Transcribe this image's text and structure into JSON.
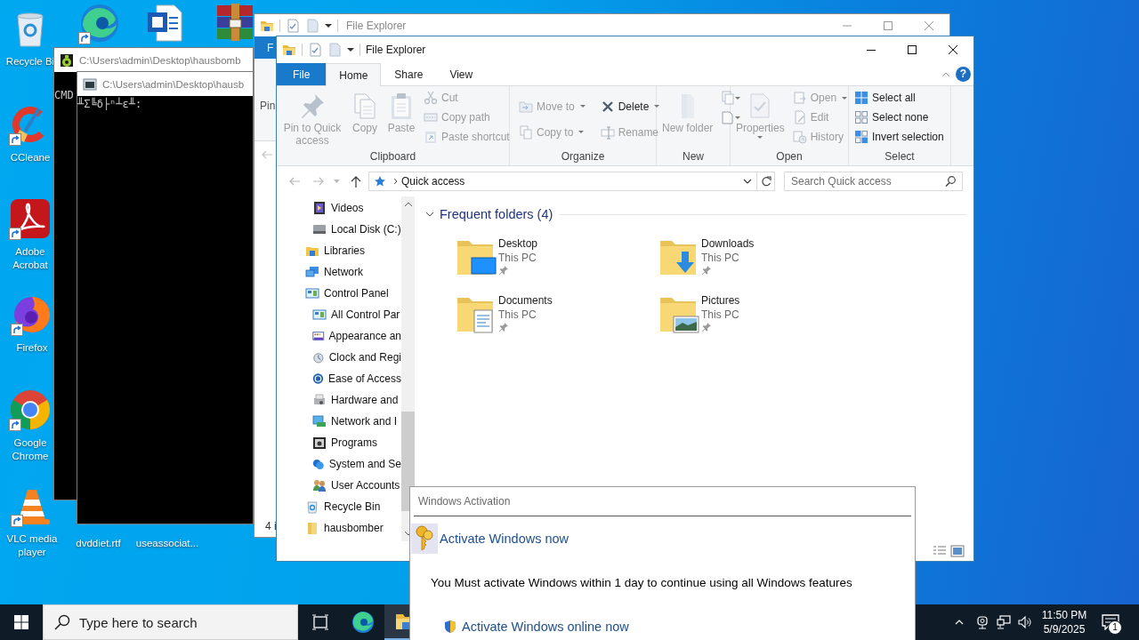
{
  "desktop": {
    "icons": [
      {
        "label": "Recycle Bi",
        "shortcut": false
      },
      {
        "shortcut": true
      },
      {
        "shortcut": false
      },
      {
        "shortcut": false
      },
      {
        "label": "CCleane",
        "shortcut": true
      },
      {
        "label": "Adobe Acrobat",
        "shortcut": true
      },
      {
        "label": "Firefox",
        "shortcut": true
      },
      {
        "label": "Google Chrome",
        "shortcut": true
      },
      {
        "label": "VLC media player",
        "shortcut": true
      },
      {
        "label": "dvddiet.rtf"
      },
      {
        "label": "useassociat..."
      }
    ]
  },
  "consoles": [
    {
      "title": "C:\\Users\\admin\\Desktop\\hausbomb",
      "output": "CMD"
    },
    {
      "title": "C:\\Users\\admin\\Desktop\\hausb",
      "output": "╨Σ╚δ├ⁿ┴ε╨:"
    }
  ],
  "explorer_back": {
    "title": "File Explorer",
    "file_tab": "F",
    "ribbon_text": "Pin",
    "status": "4 i"
  },
  "explorer": {
    "title": "File Explorer",
    "help_label": "?",
    "tabs": [
      {
        "label": "File",
        "kind": "menu",
        "selected": false
      },
      {
        "label": "Home",
        "kind": "tab",
        "selected": true
      },
      {
        "label": "Share",
        "kind": "tab",
        "selected": false
      },
      {
        "label": "View",
        "kind": "tab",
        "selected": false
      }
    ],
    "ribbon": [
      {
        "label": "Clipboard",
        "columns": [
          [
            {
              "kind": "large",
              "label": "Pin to Quick access",
              "disabled": true
            }
          ],
          [
            {
              "kind": "large",
              "label": "Copy",
              "disabled": true
            }
          ],
          [
            {
              "kind": "large",
              "label": "Paste",
              "disabled": true
            }
          ],
          [
            {
              "kind": "small",
              "label": "Cut",
              "disabled": true
            },
            {
              "kind": "small",
              "label": "Copy path",
              "disabled": true
            },
            {
              "kind": "small",
              "label": "Paste shortcut",
              "disabled": true
            }
          ]
        ]
      },
      {
        "label": "Organize",
        "columns": [
          [
            {
              "kind": "small",
              "label": "Move to",
              "disabled": true,
              "dropdown": true
            },
            {
              "kind": "small",
              "label": "Copy to",
              "disabled": true,
              "dropdown": true
            }
          ],
          [
            {
              "kind": "small",
              "label": "Delete",
              "disabled": false,
              "dropdown": true
            },
            {
              "kind": "small",
              "label": "Rename",
              "disabled": true
            }
          ]
        ]
      },
      {
        "label": "New",
        "columns": [
          [
            {
              "kind": "large",
              "label": "New folder",
              "disabled": true
            }
          ],
          [
            {
              "kind": "icon",
              "disabled": true,
              "dropdown": true
            },
            {
              "kind": "icon",
              "disabled": true,
              "dropdown": true
            }
          ]
        ]
      },
      {
        "label": "Open",
        "columns": [
          [
            {
              "kind": "large",
              "label": "Properties",
              "disabled": true,
              "dropdown": true
            }
          ],
          [
            {
              "kind": "small",
              "label": "Open",
              "disabled": true,
              "dropdown": true
            },
            {
              "kind": "small",
              "label": "Edit",
              "disabled": true
            },
            {
              "kind": "small",
              "label": "History",
              "disabled": true
            }
          ]
        ]
      },
      {
        "label": "Select",
        "columns": [
          [
            {
              "kind": "small",
              "label": "Select all",
              "disabled": false
            },
            {
              "kind": "small",
              "label": "Select none",
              "disabled": false
            },
            {
              "kind": "small",
              "label": "Invert selection",
              "disabled": false
            }
          ]
        ]
      }
    ],
    "address": {
      "path": "Quick access"
    },
    "search": {
      "placeholder": "Search Quick access"
    },
    "navigation": [
      {
        "children": [
          {
            "label": "Videos"
          },
          {
            "label": "Local Disk (C:)"
          }
        ]
      },
      {
        "label": "Libraries"
      },
      {
        "label": "Network"
      },
      {
        "label": "Control Panel",
        "children": [
          {
            "label": "All Control Par"
          },
          {
            "label": "Appearance an"
          },
          {
            "label": "Clock and Regi"
          },
          {
            "label": "Ease of Access"
          },
          {
            "label": "Hardware and"
          },
          {
            "label": "Network and I"
          },
          {
            "label": "Programs"
          },
          {
            "label": "System and Se"
          },
          {
            "label": "User Accounts"
          }
        ]
      },
      {
        "label": "Recycle Bin"
      },
      {
        "label": "hausbomber"
      }
    ],
    "frequent_folders": {
      "title": "Frequent folders (4)",
      "expanded": true,
      "items": [
        {
          "name": "Desktop",
          "location": "This PC",
          "pinned": true
        },
        {
          "name": "Downloads",
          "location": "This PC",
          "pinned": true
        },
        {
          "name": "Documents",
          "location": "This PC",
          "pinned": true
        },
        {
          "name": "Pictures",
          "location": "This PC",
          "pinned": true
        }
      ]
    }
  },
  "activation_dialog": {
    "title": "Windows Activation",
    "heading": "Activate Windows now",
    "message": "You Must activate Windows within 1 day to continue using all Windows features",
    "link": "Activate Windows online now"
  },
  "taskbar": {
    "search": {
      "placeholder": "Type here to search"
    },
    "time": "11:50 PM",
    "date": "5/9/2025",
    "notification_count": "1"
  }
}
